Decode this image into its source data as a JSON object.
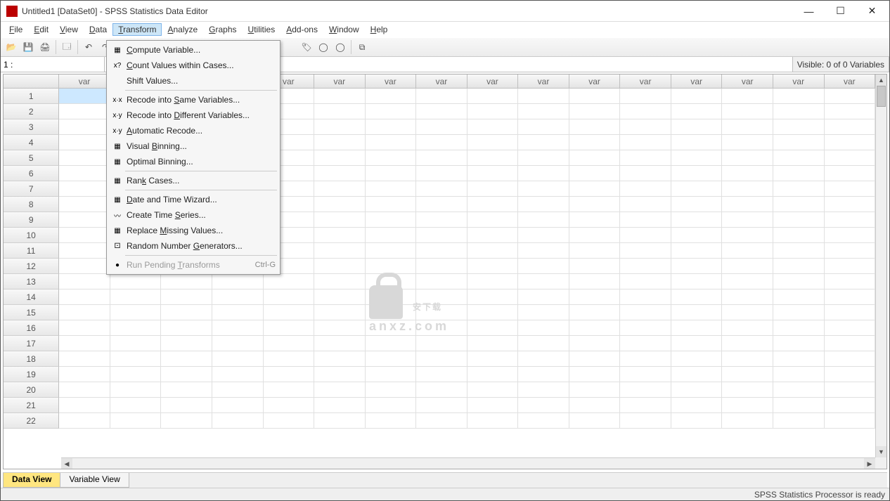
{
  "window": {
    "title": "Untitled1 [DataSet0] - SPSS Statistics Data Editor",
    "min": "—",
    "max": "☐",
    "close": "✕"
  },
  "menus": [
    "File",
    "Edit",
    "View",
    "Data",
    "Transform",
    "Analyze",
    "Graphs",
    "Utilities",
    "Add-ons",
    "Window",
    "Help"
  ],
  "activeMenu": 4,
  "inforow": {
    "left": "1 :",
    "right": "Visible: 0 of 0 Variables"
  },
  "colHeader": "var",
  "numCols": 16,
  "numRows": 22,
  "selectedRow": 1,
  "selectedCol": 1,
  "dropdown": [
    {
      "icon": "▦",
      "label": "Compute Variable...",
      "u": 0
    },
    {
      "icon": "x?",
      "label": "Count Values within Cases...",
      "u": 0
    },
    {
      "icon": "",
      "label": "Shift Values...",
      "u": -1
    },
    {
      "sep": true
    },
    {
      "icon": "x·x",
      "label": "Recode into Same Variables...",
      "u": 12
    },
    {
      "icon": "x·y",
      "label": "Recode into Different Variables...",
      "u": 12
    },
    {
      "icon": "x·y",
      "label": "Automatic Recode...",
      "u": 0
    },
    {
      "icon": "▦",
      "label": "Visual Binning...",
      "u": 7
    },
    {
      "icon": "▦",
      "label": "Optimal Binning...",
      "u": -1
    },
    {
      "sep": true
    },
    {
      "icon": "▦",
      "label": "Rank Cases...",
      "u": 3
    },
    {
      "sep": true
    },
    {
      "icon": "▦",
      "label": "Date and Time Wizard...",
      "u": 0
    },
    {
      "icon": "〰",
      "label": "Create Time Series...",
      "u": 12
    },
    {
      "icon": "▦",
      "label": "Replace Missing Values...",
      "u": 8
    },
    {
      "icon": "⚀",
      "label": "Random Number Generators...",
      "u": 14
    },
    {
      "sep": true
    },
    {
      "icon": "●",
      "label": "Run Pending Transforms",
      "shortcut": "Ctrl-G",
      "disabled": true,
      "u": 12
    }
  ],
  "tabs": {
    "dataView": "Data View",
    "varView": "Variable View"
  },
  "status": "SPSS Statistics Processor is ready",
  "watermark": {
    "main": "安下载",
    "sub": "anxz.com"
  }
}
